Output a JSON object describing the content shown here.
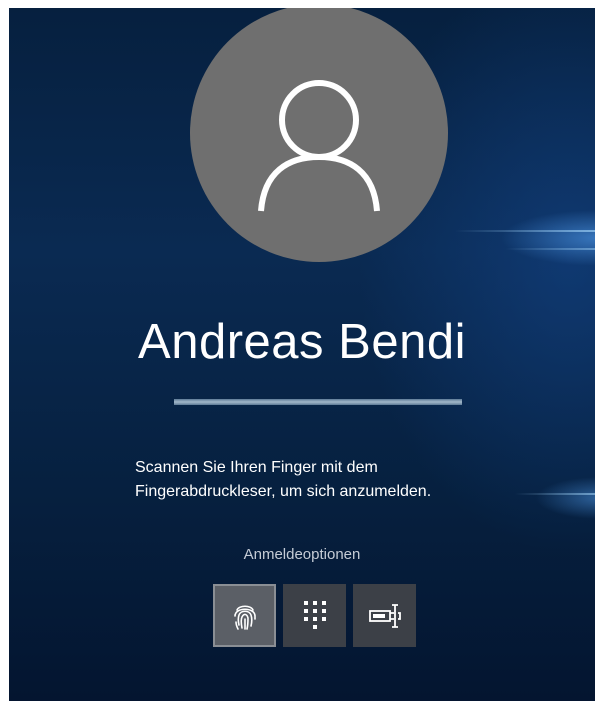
{
  "user": {
    "name": "Andreas Bendi",
    "avatar_icon": "user-silhouette-icon"
  },
  "progress": {
    "value": 1.0
  },
  "prompt": {
    "line1": "Scannen Sie Ihren Finger mit dem",
    "line2": "Fingerabdruckleser, um sich anzumelden."
  },
  "sign_in_options": {
    "label": "Anmeldeoptionen",
    "items": [
      {
        "icon": "fingerprint-icon",
        "selected": true
      },
      {
        "icon": "pin-keypad-icon",
        "selected": false
      },
      {
        "icon": "password-key-icon",
        "selected": false
      }
    ]
  },
  "colors": {
    "background": "#0a2a52",
    "avatar": "#6f6f6f",
    "option_selected": "#5b5f66",
    "option": "#3c4047"
  }
}
